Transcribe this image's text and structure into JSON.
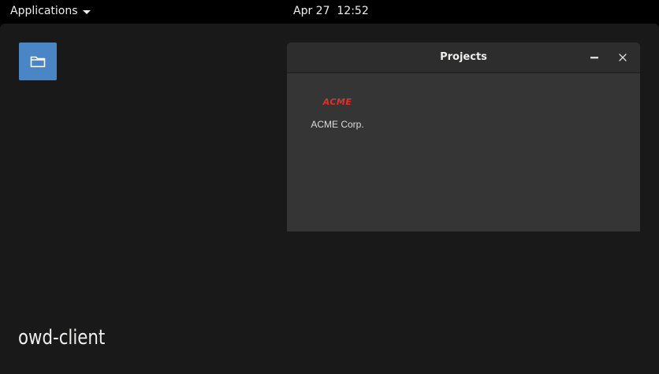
{
  "topbar": {
    "applications_label": "Applications",
    "date": "Apr 27",
    "time": "12:52"
  },
  "desktop": {
    "launcher_icon": "folder-icon",
    "footer_label": "owd-client"
  },
  "window": {
    "title": "Projects",
    "minimize_icon": "minimize-icon",
    "close_icon": "close-icon",
    "projects": [
      {
        "logo_text": "ACME",
        "name": "ACME Corp."
      }
    ]
  },
  "colors": {
    "topbar_bg": "#000000",
    "desktop_bg": "#191919",
    "window_bg": "#353535",
    "titlebar_bg": "#2d2d2d",
    "launcher_accent": "#4a86c5",
    "acme_logo": "#e0302e"
  }
}
